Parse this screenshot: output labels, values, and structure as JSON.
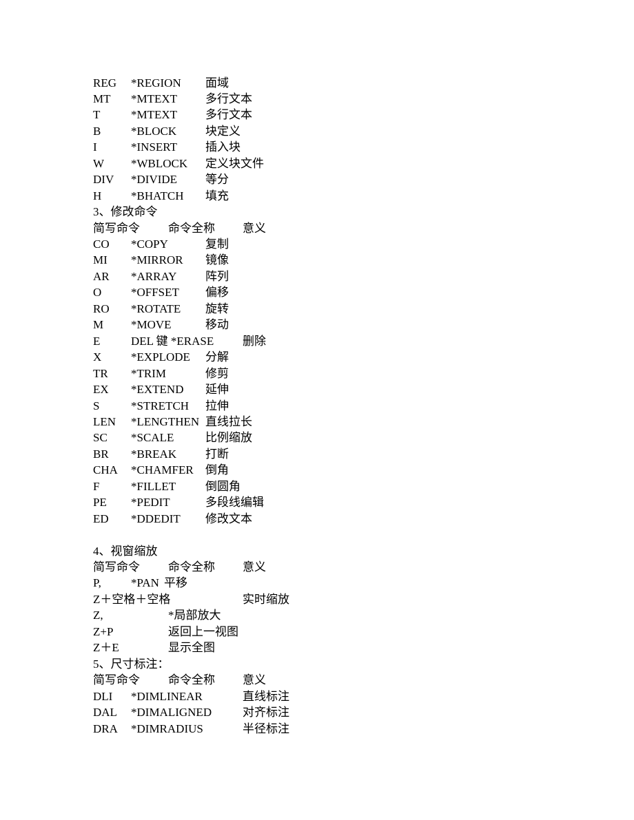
{
  "rows": [
    {
      "type": "cmd",
      "abbr": "REG",
      "full": "*REGION",
      "meaning": "面域"
    },
    {
      "type": "cmd",
      "abbr": "MT",
      "full": "*MTEXT",
      "meaning": "多行文本"
    },
    {
      "type": "cmd",
      "abbr": "T",
      "full": "*MTEXT",
      "meaning": "多行文本"
    },
    {
      "type": "cmd",
      "abbr": "B",
      "full": "*BLOCK",
      "meaning": "块定义"
    },
    {
      "type": "cmd",
      "abbr": "I",
      "full": "*INSERT",
      "meaning": "插入块"
    },
    {
      "type": "cmd",
      "abbr": "W",
      "full": "*WBLOCK",
      "meaning": "定义块文件"
    },
    {
      "type": "cmd",
      "abbr": "DIV",
      "full": "*DIVIDE",
      "meaning": "等分"
    },
    {
      "type": "cmd",
      "abbr": "H",
      "full": "*BHATCH",
      "meaning": "填充"
    },
    {
      "type": "heading",
      "text": "3、修改命令"
    },
    {
      "type": "header",
      "abbr": "简写命令",
      "full": "命令全称",
      "meaning": "意义"
    },
    {
      "type": "cmd",
      "abbr": "CO",
      "full": "*COPY",
      "meaning": "复制"
    },
    {
      "type": "cmd",
      "abbr": "MI",
      "full": "*MIRROR",
      "meaning": "镜像"
    },
    {
      "type": "cmd",
      "abbr": "AR",
      "full": "*ARRAY",
      "meaning": "阵列"
    },
    {
      "type": "cmd",
      "abbr": "O",
      "full": "*OFFSET",
      "meaning": "偏移"
    },
    {
      "type": "cmd",
      "abbr": "RO",
      "full": "*ROTATE",
      "meaning": "旋转"
    },
    {
      "type": "cmd",
      "abbr": "M",
      "full": "*MOVE",
      "meaning": "移动"
    },
    {
      "type": "cmdwide",
      "abbr": "E",
      "full": "DEL 键 *ERASE",
      "meaning": "删除"
    },
    {
      "type": "cmd",
      "abbr": "X",
      "full": "*EXPLODE",
      "meaning": "分解"
    },
    {
      "type": "cmd",
      "abbr": "TR",
      "full": "*TRIM",
      "meaning": "修剪"
    },
    {
      "type": "cmd",
      "abbr": "EX",
      "full": "*EXTEND",
      "meaning": "延伸"
    },
    {
      "type": "cmd",
      "abbr": "S",
      "full": "*STRETCH",
      "meaning": "拉伸"
    },
    {
      "type": "cmd",
      "abbr": "LEN",
      "full": "*LENGTHEN",
      "meaning": "直线拉长"
    },
    {
      "type": "cmd",
      "abbr": "SC",
      "full": "*SCALE",
      "meaning": "比例缩放"
    },
    {
      "type": "cmd",
      "abbr": "BR",
      "full": "*BREAK",
      "meaning": "打断"
    },
    {
      "type": "cmd",
      "abbr": "CHA",
      "full": "*CHAMFER",
      "meaning": "倒角"
    },
    {
      "type": "cmd",
      "abbr": "F",
      "full": "*FILLET",
      "meaning": "倒圆角"
    },
    {
      "type": "cmd",
      "abbr": "PE",
      "full": "*PEDIT",
      "meaning": "多段线编辑"
    },
    {
      "type": "cmd",
      "abbr": "ED",
      "full": "*DDEDIT",
      "meaning": "修改文本"
    },
    {
      "type": "blank"
    },
    {
      "type": "heading",
      "text": "4、视窗缩放"
    },
    {
      "type": "header",
      "abbr": "简写命令",
      "full": "命令全称",
      "meaning": "意义"
    },
    {
      "type": "pan",
      "abbr": "P,",
      "full": "*PAN",
      "meaning": "平移"
    },
    {
      "type": "zoomrt",
      "abbr": "Z＋空格＋空格",
      "meaning": "实时缩放"
    },
    {
      "type": "zoomtwo",
      "abbr": "Z,",
      "full": "*局部放大"
    },
    {
      "type": "zoomtwo",
      "abbr": "Z+P",
      "full": "返回上一视图"
    },
    {
      "type": "zoomtwo",
      "abbr": "Z＋E",
      "full": "显示全图"
    },
    {
      "type": "heading",
      "text": "5、尺寸标注："
    },
    {
      "type": "header",
      "abbr": "简写命令",
      "full": "命令全称",
      "meaning": "意义"
    },
    {
      "type": "dim",
      "abbr": "DLI",
      "full": "*DIMLINEAR",
      "meaning": "直线标注"
    },
    {
      "type": "dim",
      "abbr": "DAL",
      "full": "*DIMALIGNED",
      "meaning": "对齐标注"
    },
    {
      "type": "dim",
      "abbr": "DRA",
      "full": "*DIMRADIUS",
      "meaning": "半径标注"
    }
  ]
}
